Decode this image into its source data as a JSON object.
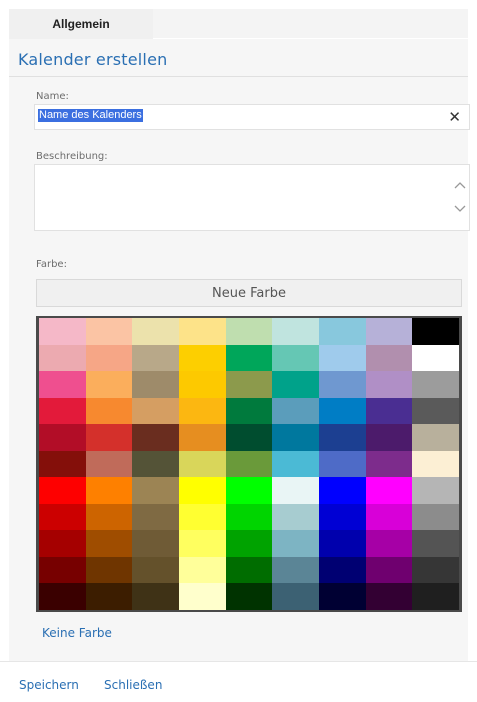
{
  "tabs": {
    "active": "Allgemein"
  },
  "header": {
    "title": "Kalender erstellen"
  },
  "form": {
    "name_label": "Name:",
    "name_value": "Name des Kalenders",
    "clear_glyph": "✕",
    "description_label": "Beschreibung:",
    "description_value": "",
    "color_label": "Farbe:",
    "new_color_label": "Neue Farbe",
    "no_color_label": "Keine Farbe"
  },
  "palette_colors": [
    [
      "#f5b8c8",
      "#fbc4a4",
      "#ece2ac",
      "#fde389",
      "#bfdeaf",
      "#c0e4df",
      "#88c8dd",
      "#b6b1d8",
      "#000000"
    ],
    [
      "#ecaab0",
      "#f6a686",
      "#b8a889",
      "#fdcf00",
      "#00a65a",
      "#65c7b4",
      "#9fcbec",
      "#b18fae",
      "#ffffff"
    ],
    [
      "#ef4f8f",
      "#fbae5c",
      "#9e8b6a",
      "#fdc900",
      "#8c9a4c",
      "#00a28a",
      "#6f98d0",
      "#b08fc6",
      "#9c9c9c"
    ],
    [
      "#e31a3a",
      "#f7892f",
      "#d59e62",
      "#fcb711",
      "#007a3d",
      "#5b9dbb",
      "#007dc5",
      "#4a2e92",
      "#5a5a5a"
    ],
    [
      "#b20d27",
      "#d4302b",
      "#6a2d1f",
      "#e68e20",
      "#004d2f",
      "#00789e",
      "#1c3f91",
      "#4c1b6b",
      "#b8b09c"
    ],
    [
      "#840f0a",
      "#c06b5a",
      "#545337",
      "#d9d65a",
      "#6a9a3a",
      "#4bbad5",
      "#4e6bc7",
      "#7d2c8c",
      "#fcefd4"
    ],
    [
      "#fe0000",
      "#fe8000",
      "#9c8454",
      "#ffff00",
      "#00ff00",
      "#e9f5f5",
      "#0000ff",
      "#ff00ff",
      "#b5b5b5"
    ],
    [
      "#cc0000",
      "#cd6400",
      "#7f6a43",
      "#ffff31",
      "#00d500",
      "#a7ccd0",
      "#0000d4",
      "#d800d8",
      "#8c8c8c"
    ],
    [
      "#a50000",
      "#9f4d00",
      "#6f5b36",
      "#ffff5f",
      "#00a300",
      "#7db4c3",
      "#0000ad",
      "#a600a6",
      "#545454"
    ],
    [
      "#770000",
      "#6f3500",
      "#64512b",
      "#ffff9a",
      "#006d00",
      "#5b8596",
      "#000072",
      "#6f006f",
      "#363636"
    ],
    [
      "#3a0000",
      "#3c1d00",
      "#3f3216",
      "#ffffcc",
      "#003300",
      "#3c6173",
      "#000033",
      "#330033",
      "#1f1f1f"
    ]
  ],
  "footer": {
    "save_label": "Speichern",
    "close_label": "Schließen"
  }
}
